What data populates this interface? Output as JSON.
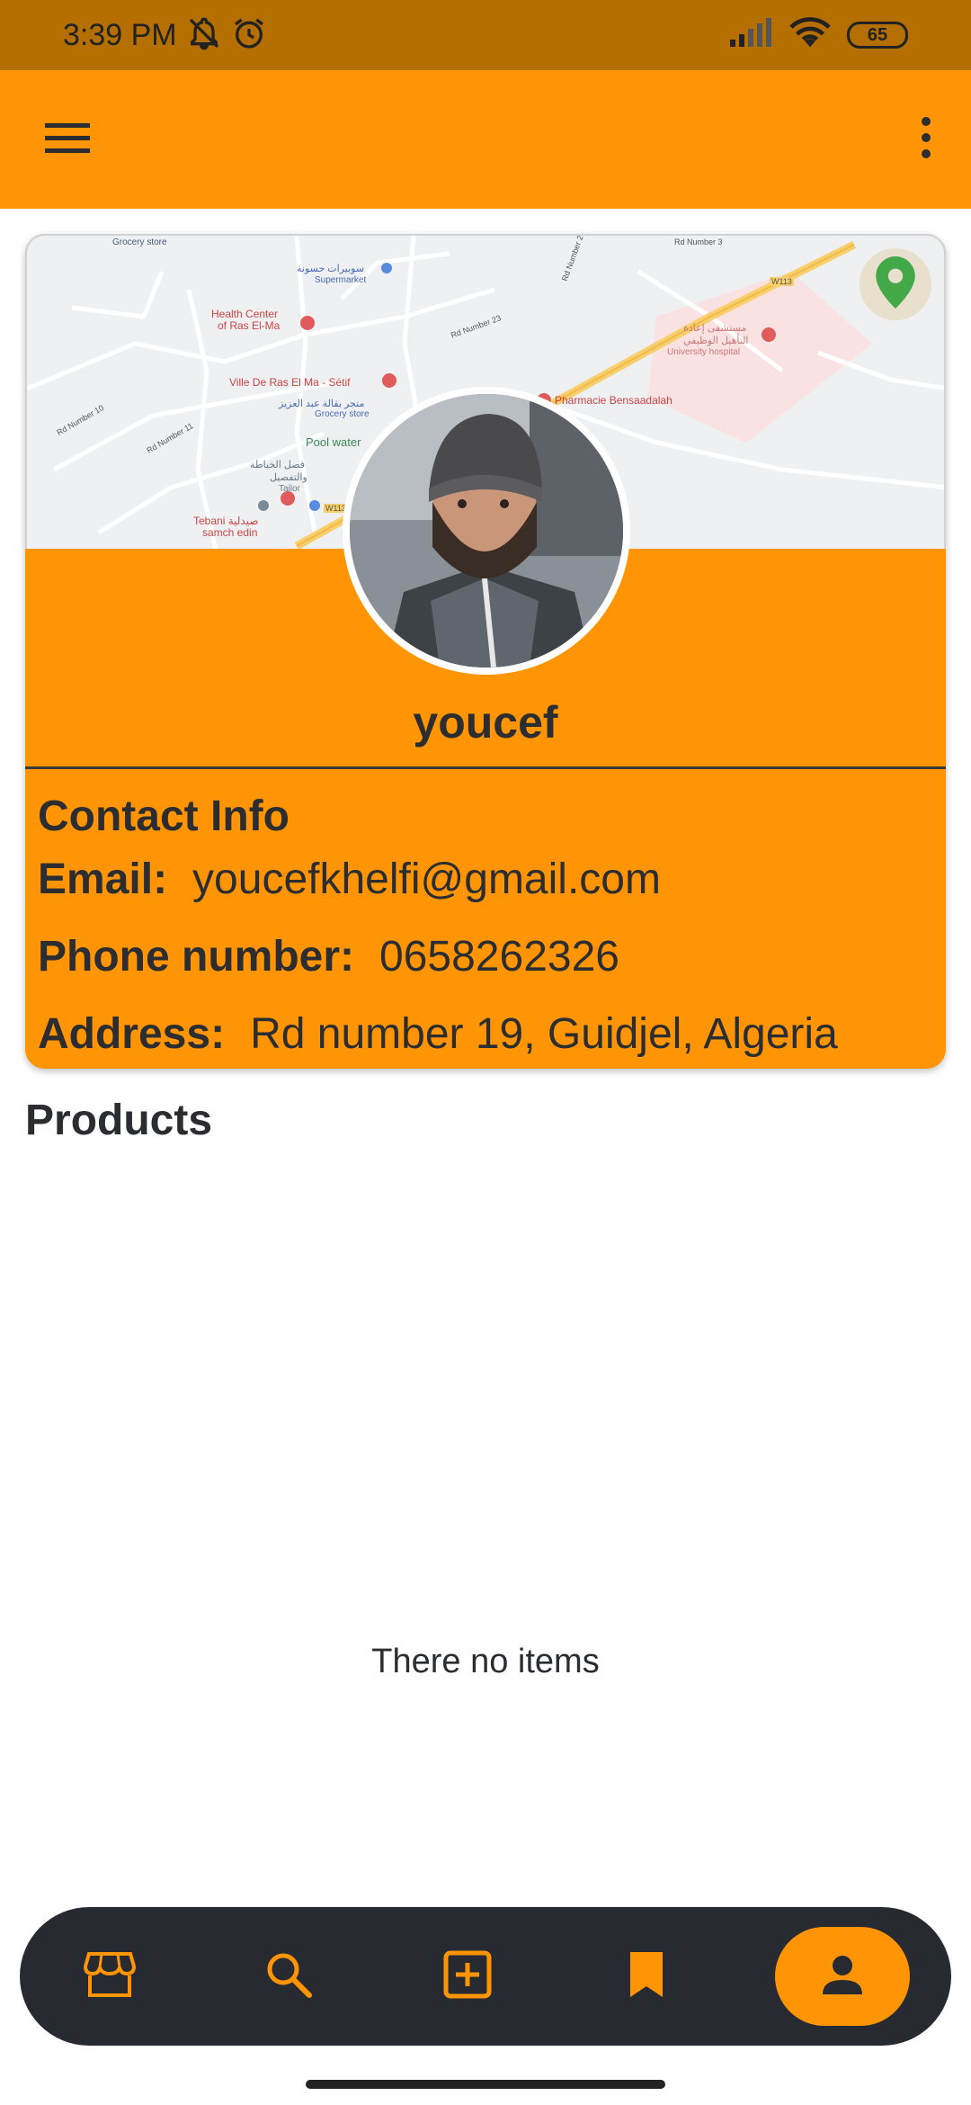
{
  "status_bar": {
    "time": "3:39 PM",
    "battery": "65"
  },
  "app_bar": {
    "menu_icon": "menu-icon",
    "overflow_icon": "more-vert-icon"
  },
  "profile": {
    "username": "youcef",
    "contact_title": "Contact Info",
    "email_label": "Email:",
    "email": "youcefkhelfi@gmail.com",
    "phone_label": "Phone number:",
    "phone": "0658262326",
    "address_label": "Address:",
    "address": "Rd number 19, Guidjel, Algeria"
  },
  "map_labels": {
    "l1": "Grocery store",
    "l2": "سوبيرات حسونة",
    "l3": "Supermarket",
    "l4": "Health Center",
    "l5": "of Ras El-Ma",
    "l6": "Ville De Ras El Ma - Sétif",
    "l7": "متجر بقالة عبد العزيز",
    "l8": "Grocery store",
    "l9": "Pool water",
    "l10": "فصل الخياطة",
    "l11": "والتفصيل",
    "l12": "Tailor",
    "l13": "Tebani صيدلية",
    "l14": "samch edin",
    "l15": "Pharmacie Bensaadalah",
    "l16": "مستشفى إعادة",
    "l17": "التأهيل الوظيفي",
    "l18": "University hospital",
    "l19": "Rd Number 23",
    "l20": "Rd Number 2",
    "l21": "Rd Number 3",
    "l22": "Rd Number 10",
    "l23": "Rd Number 11",
    "l24": "W113",
    "l25": "W113"
  },
  "products": {
    "title": "Products",
    "empty_text": "There no items"
  },
  "bottom_nav": {
    "items": [
      "store-icon",
      "search-icon",
      "add-box-icon",
      "bookmark-icon",
      "person-icon"
    ],
    "active": "person-icon"
  },
  "colors": {
    "accent": "#ff9505",
    "status_bar": "#b56f00",
    "dark": "#272a30",
    "text": "#2b2d31"
  }
}
